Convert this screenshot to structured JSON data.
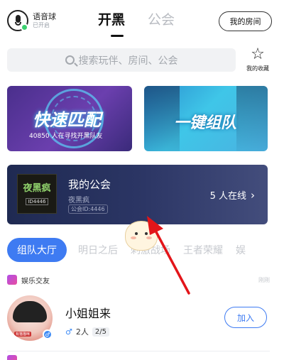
{
  "header": {
    "voice_title": "语音球",
    "voice_status": "已开启",
    "tabs": [
      {
        "label": "开黑",
        "active": true
      },
      {
        "label": "公会",
        "active": false
      }
    ],
    "my_room": "我的房间"
  },
  "search": {
    "placeholder": "搜索玩伴、房间、公会",
    "favorites_label": "我的收藏"
  },
  "cards": {
    "quick_match": {
      "title": "快速匹配",
      "subtitle": "40850 人在寻找开黑队友"
    },
    "team_up": {
      "title": "一键组队"
    }
  },
  "guild": {
    "title": "我的公会",
    "logo_text": "夜黑疯",
    "logo_id": "ID4446",
    "guild_name": "夜黑疯",
    "guild_id": "公会ID:4446",
    "online": "5 人在线"
  },
  "categories": [
    {
      "label": "组队大厅",
      "active": true
    },
    {
      "label": "明日之后",
      "active": false
    },
    {
      "label": "刺激战场",
      "active": false
    },
    {
      "label": "王者荣耀",
      "active": false
    },
    {
      "label": "娱",
      "active": false
    }
  ],
  "rooms_section": {
    "category_icon_text": "娱乐交友",
    "category_label": "娱乐交友",
    "time": "刚刚",
    "room": {
      "title": "小姐姐来",
      "avatar_tag": "有猫猫咪",
      "count": "2人",
      "slots": "2/5",
      "join_label": "加入"
    }
  },
  "colors": {
    "accent": "#3e7bf2",
    "annotation_arrow": "#e3151a"
  },
  "icons": {
    "mic": "microphone-icon",
    "search": "search-icon",
    "favorites": "star-icon",
    "chevron": "chevron-right-icon",
    "male": "male-icon"
  }
}
